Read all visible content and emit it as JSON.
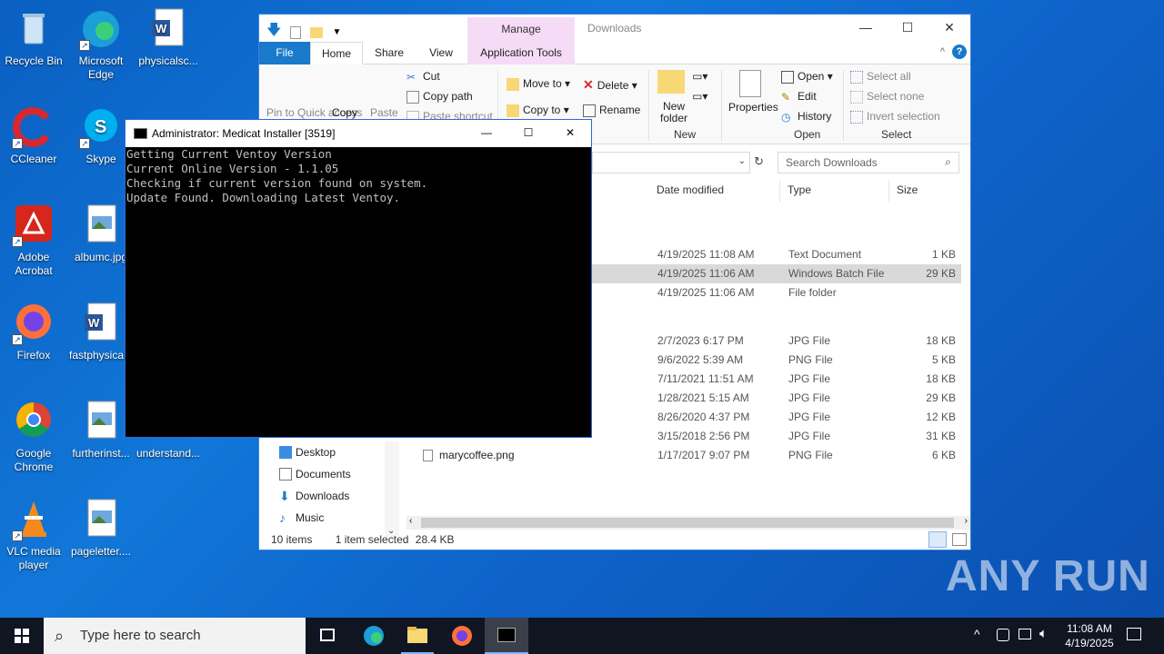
{
  "desktop": {
    "icons": [
      {
        "label": "Recycle Bin"
      },
      {
        "label": "Microsoft Edge"
      },
      {
        "label": "physicalsc..."
      },
      {
        "label": "CCleaner"
      },
      {
        "label": "Skype"
      },
      {
        "label": "Adobe Acrobat"
      },
      {
        "label": "albumc.jpg"
      },
      {
        "label": "Firefox"
      },
      {
        "label": "fastphysica..."
      },
      {
        "label": "Google Chrome"
      },
      {
        "label": "furtherinst..."
      },
      {
        "label": "understand..."
      },
      {
        "label": "VLC media player"
      },
      {
        "label": "pageletter...."
      }
    ]
  },
  "explorer": {
    "title": "Downloads",
    "manage_tab": "Manage",
    "tabs": [
      "File",
      "Home",
      "Share",
      "View",
      "Application Tools"
    ],
    "ribbon": {
      "clipboard": {
        "pin": "Pin to Quick access",
        "copy": "Copy",
        "paste": "Paste",
        "cut": "Cut",
        "copy_path": "Copy path",
        "paste_shortcut": "Paste shortcut"
      },
      "organize": {
        "move_to": "Move to",
        "copy_to": "Copy to",
        "delete": "Delete",
        "rename": "Rename"
      },
      "new": {
        "new_folder": "New folder",
        "group": "New"
      },
      "open": {
        "properties": "Properties",
        "open": "Open",
        "edit": "Edit",
        "history": "History",
        "group": "Open"
      },
      "select": {
        "select_all": "Select all",
        "select_none": "Select none",
        "invert": "Invert selection",
        "group": "Select"
      }
    },
    "search_placeholder": "Search Downloads",
    "columns": {
      "date": "Date modified",
      "type": "Type",
      "size": "Size"
    },
    "rows": [
      {
        "name": "",
        "date": "4/19/2025 11:08 AM",
        "type": "Text Document",
        "size": "1 KB",
        "selected": false
      },
      {
        "name": "",
        "date": "4/19/2025 11:06 AM",
        "type": "Windows Batch File",
        "size": "29 KB",
        "selected": true
      },
      {
        "name": "",
        "date": "4/19/2025 11:06 AM",
        "type": "File folder",
        "size": "",
        "selected": false
      },
      {
        "name": "",
        "date": "2/7/2023 6:17 PM",
        "type": "JPG File",
        "size": "18 KB",
        "selected": false
      },
      {
        "name": "",
        "date": "9/6/2022 5:39 AM",
        "type": "PNG File",
        "size": "5 KB",
        "selected": false
      },
      {
        "name": "",
        "date": "7/11/2021 11:51 AM",
        "type": "JPG File",
        "size": "18 KB",
        "selected": false
      },
      {
        "name": "",
        "date": "1/28/2021 5:15 AM",
        "type": "JPG File",
        "size": "29 KB",
        "selected": false
      },
      {
        "name": "",
        "date": "8/26/2020 4:37 PM",
        "type": "JPG File",
        "size": "12 KB",
        "selected": false
      },
      {
        "name": "",
        "date": "3/15/2018 2:56 PM",
        "type": "JPG File",
        "size": "31 KB",
        "selected": false
      },
      {
        "name": "marycoffee.png",
        "date": "1/17/2017 9:07 PM",
        "type": "PNG File",
        "size": "6 KB",
        "selected": false
      }
    ],
    "nav": [
      "Desktop",
      "Documents",
      "Downloads",
      "Music"
    ],
    "status": {
      "items": "10 items",
      "selected": "1 item selected",
      "size": "28.4 KB"
    }
  },
  "console": {
    "title": "Administrator:  Medicat Installer [3519]",
    "lines": [
      "Getting Current Ventoy Version",
      "Current Online Version - 1.1.05",
      "Checking if current version found on system.",
      "Update Found. Downloading Latest Ventoy."
    ]
  },
  "taskbar": {
    "search_placeholder": "Type here to search",
    "time": "11:08 AM",
    "date": "4/19/2025"
  },
  "watermark": "ANY RUN"
}
